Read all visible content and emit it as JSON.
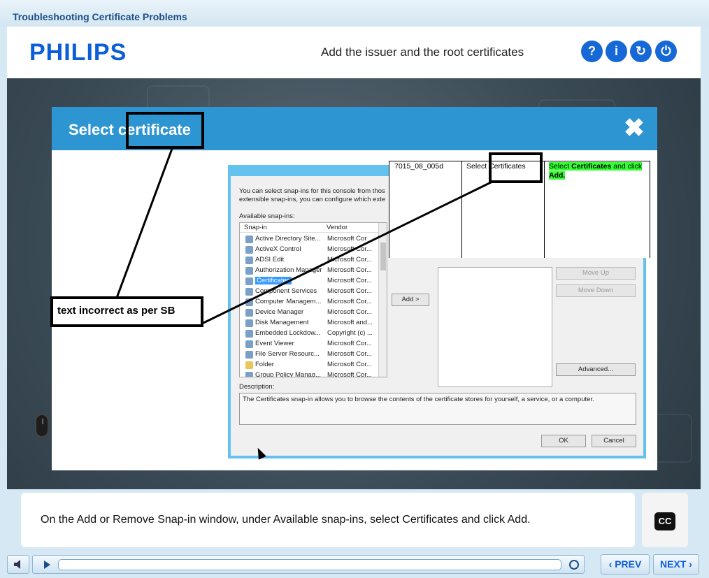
{
  "app": {
    "title": "Troubleshooting Certificate Problems"
  },
  "header": {
    "logo": "PHILIPS",
    "slide_title": "Add the issuer and the root certificates",
    "buttons": [
      {
        "name": "help",
        "glyph": "?"
      },
      {
        "name": "info",
        "glyph": "i"
      },
      {
        "name": "replay",
        "glyph": "↻"
      },
      {
        "name": "power",
        "glyph": "⏻"
      }
    ]
  },
  "dialog": {
    "title": "Select certificate",
    "close_glyph": "✖",
    "annotation": "text incorrect as per SB"
  },
  "mmc": {
    "intro_line1": "You can select snap-ins for this console from thos",
    "intro_line2": "extensible snap-ins, you can configure which exte",
    "available_label": "Available snap-ins:",
    "col_snapin": "Snap-in",
    "col_vendor": "Vendor",
    "rows": [
      {
        "name": "Active Directory Site...",
        "vendor": "Microsoft Cor"
      },
      {
        "name": "ActiveX Control",
        "vendor": "Microsoft Cor..."
      },
      {
        "name": "ADSI Edit",
        "vendor": "Microsoft Cor..."
      },
      {
        "name": "Authorization Manager",
        "vendor": "Microsoft Cor..."
      },
      {
        "name": "Certificates",
        "vendor": "Microsoft Cor..."
      },
      {
        "name": "Component Services",
        "vendor": "Microsoft Cor..."
      },
      {
        "name": "Computer Managem...",
        "vendor": "Microsoft Cor..."
      },
      {
        "name": "Device Manager",
        "vendor": "Microsoft Cor..."
      },
      {
        "name": "Disk Management",
        "vendor": "Microsoft and..."
      },
      {
        "name": "Embedded Lockdow...",
        "vendor": "Copyright (c) ..."
      },
      {
        "name": "Event Viewer",
        "vendor": "Microsoft Cor..."
      },
      {
        "name": "File Server Resourc...",
        "vendor": "Microsoft Cor..."
      },
      {
        "name": "Folder",
        "vendor": "Microsoft Cor..."
      },
      {
        "name": "Group Policy Manag...",
        "vendor": "Microsoft Cor..."
      }
    ],
    "add_button": "Add >",
    "move_up": "Move Up",
    "move_down": "Move Down",
    "advanced": "Advanced...",
    "description_label": "Description:",
    "description": "The Certificates snap-in allows you to browse the contents of the certificate stores for yourself, a service, or a computer.",
    "ok": "OK",
    "cancel": "Cancel"
  },
  "table_fragment": {
    "id": "7015_08_005d",
    "col2": "Select Certificates",
    "col3_a": "Select ",
    "col3_b": "Certificates",
    "col3_c": " and click",
    "col3_d": "Add."
  },
  "caption": {
    "text": "On the Add or Remove Snap-in window, under Available snap-ins, select Certificates and click Add.",
    "cc_label": "CC"
  },
  "controls": {
    "prev": "PREV",
    "next": "NEXT"
  }
}
